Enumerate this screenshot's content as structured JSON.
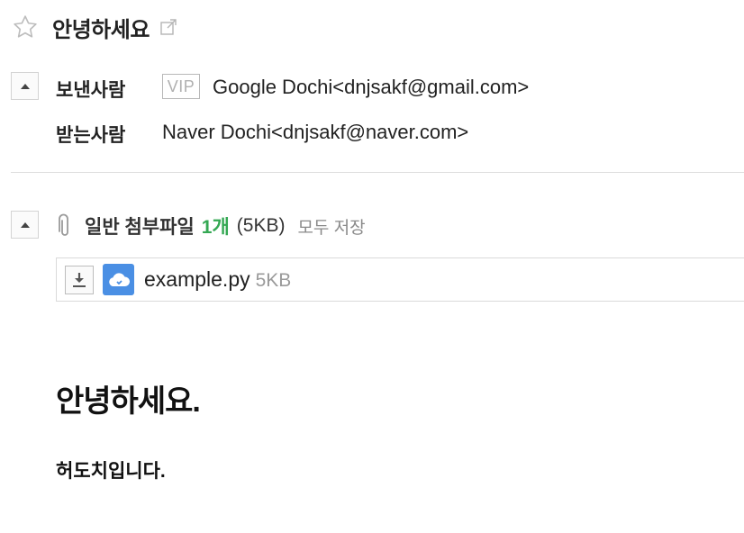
{
  "mail": {
    "subject": "안녕하세요",
    "sender": {
      "label": "보낸사람",
      "badge": "VIP",
      "value": "Google Dochi<dnjsakf@gmail.com>"
    },
    "recipient": {
      "label": "받는사람",
      "value": "Naver Dochi<dnjsakf@naver.com>"
    }
  },
  "attachments": {
    "label": "일반 첨부파일",
    "count": "1개",
    "total_size": "(5KB)",
    "save_all": "모두 저장",
    "files": [
      {
        "name": "example.py",
        "size": "5KB"
      }
    ]
  },
  "body": {
    "heading": "안녕하세요.",
    "text": "허도치입니다."
  },
  "icons": {
    "star": "star-outline-icon",
    "popout": "external-link-icon",
    "toggle": "collapse-up-icon",
    "paperclip": "paperclip-icon",
    "download": "download-icon",
    "cloud": "cloud-save-icon"
  },
  "colors": {
    "count_green": "#34a853",
    "cloud_blue": "#4a8fe4",
    "muted_gray": "#8a8a8a"
  }
}
